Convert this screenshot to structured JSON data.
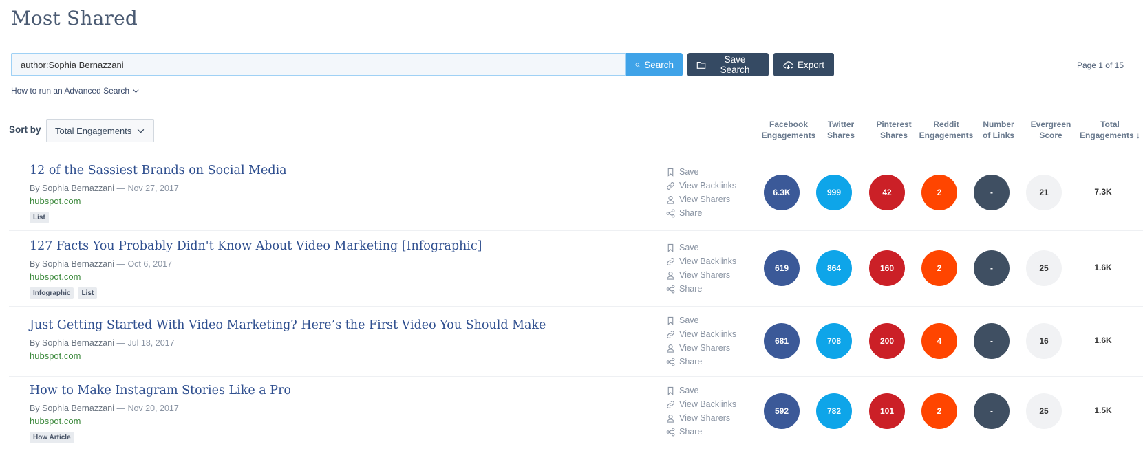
{
  "page_title": "Most Shared",
  "search": {
    "value": "author:Sophia Bernazzani",
    "search_label": "Search",
    "save_label": "Save Search",
    "export_label": "Export"
  },
  "pagination": "Page 1 of 15",
  "advanced_link": "How to run an Advanced Search",
  "sort": {
    "label": "Sort by",
    "selected": "Total Engagements"
  },
  "columns": [
    {
      "line1": "Facebook",
      "line2": "Engagements"
    },
    {
      "line1": "Twitter",
      "line2": "Shares"
    },
    {
      "line1": "Pinterest",
      "line2": "Shares"
    },
    {
      "line1": "Reddit",
      "line2": "Engagements"
    },
    {
      "line1": "Number",
      "line2": "of Links"
    },
    {
      "line1": "Evergreen",
      "line2": "Score"
    },
    {
      "line1": "Total",
      "line2": "Engagements",
      "sort_arrow": "↓"
    }
  ],
  "action_labels": {
    "save": "Save",
    "backlinks": "View Backlinks",
    "sharers": "View Sharers",
    "share": "Share"
  },
  "results": [
    {
      "title": "12 of the Sassiest Brands on Social Media",
      "author": "By Sophia Bernazzani",
      "date": " — Nov 27, 2017",
      "domain": "hubspot.com",
      "tags": [
        "List"
      ],
      "facebook": "6.3K",
      "twitter": "999",
      "pinterest": "42",
      "reddit": "2",
      "links": "-",
      "evergreen": "21",
      "total": "7.3K"
    },
    {
      "title": "127 Facts You Probably Didn't Know About Video Marketing [Infographic]",
      "author": "By Sophia Bernazzani",
      "date": " — Oct 6, 2017",
      "domain": "hubspot.com",
      "tags": [
        "Infographic",
        "List"
      ],
      "facebook": "619",
      "twitter": "864",
      "pinterest": "160",
      "reddit": "2",
      "links": "-",
      "evergreen": "25",
      "total": "1.6K"
    },
    {
      "title": "Just Getting Started With Video Marketing? Here’s the First Video You Should Make",
      "author": "By Sophia Bernazzani",
      "date": " — Jul 18, 2017",
      "domain": "hubspot.com",
      "tags": [],
      "facebook": "681",
      "twitter": "708",
      "pinterest": "200",
      "reddit": "4",
      "links": "-",
      "evergreen": "16",
      "total": "1.6K"
    },
    {
      "title": "How to Make Instagram Stories Like a Pro",
      "author": "By Sophia Bernazzani",
      "date": " — Nov 20, 2017",
      "domain": "hubspot.com",
      "tags": [
        "How Article"
      ],
      "facebook": "592",
      "twitter": "782",
      "pinterest": "101",
      "reddit": "2",
      "links": "-",
      "evergreen": "25",
      "total": "1.5K"
    }
  ]
}
